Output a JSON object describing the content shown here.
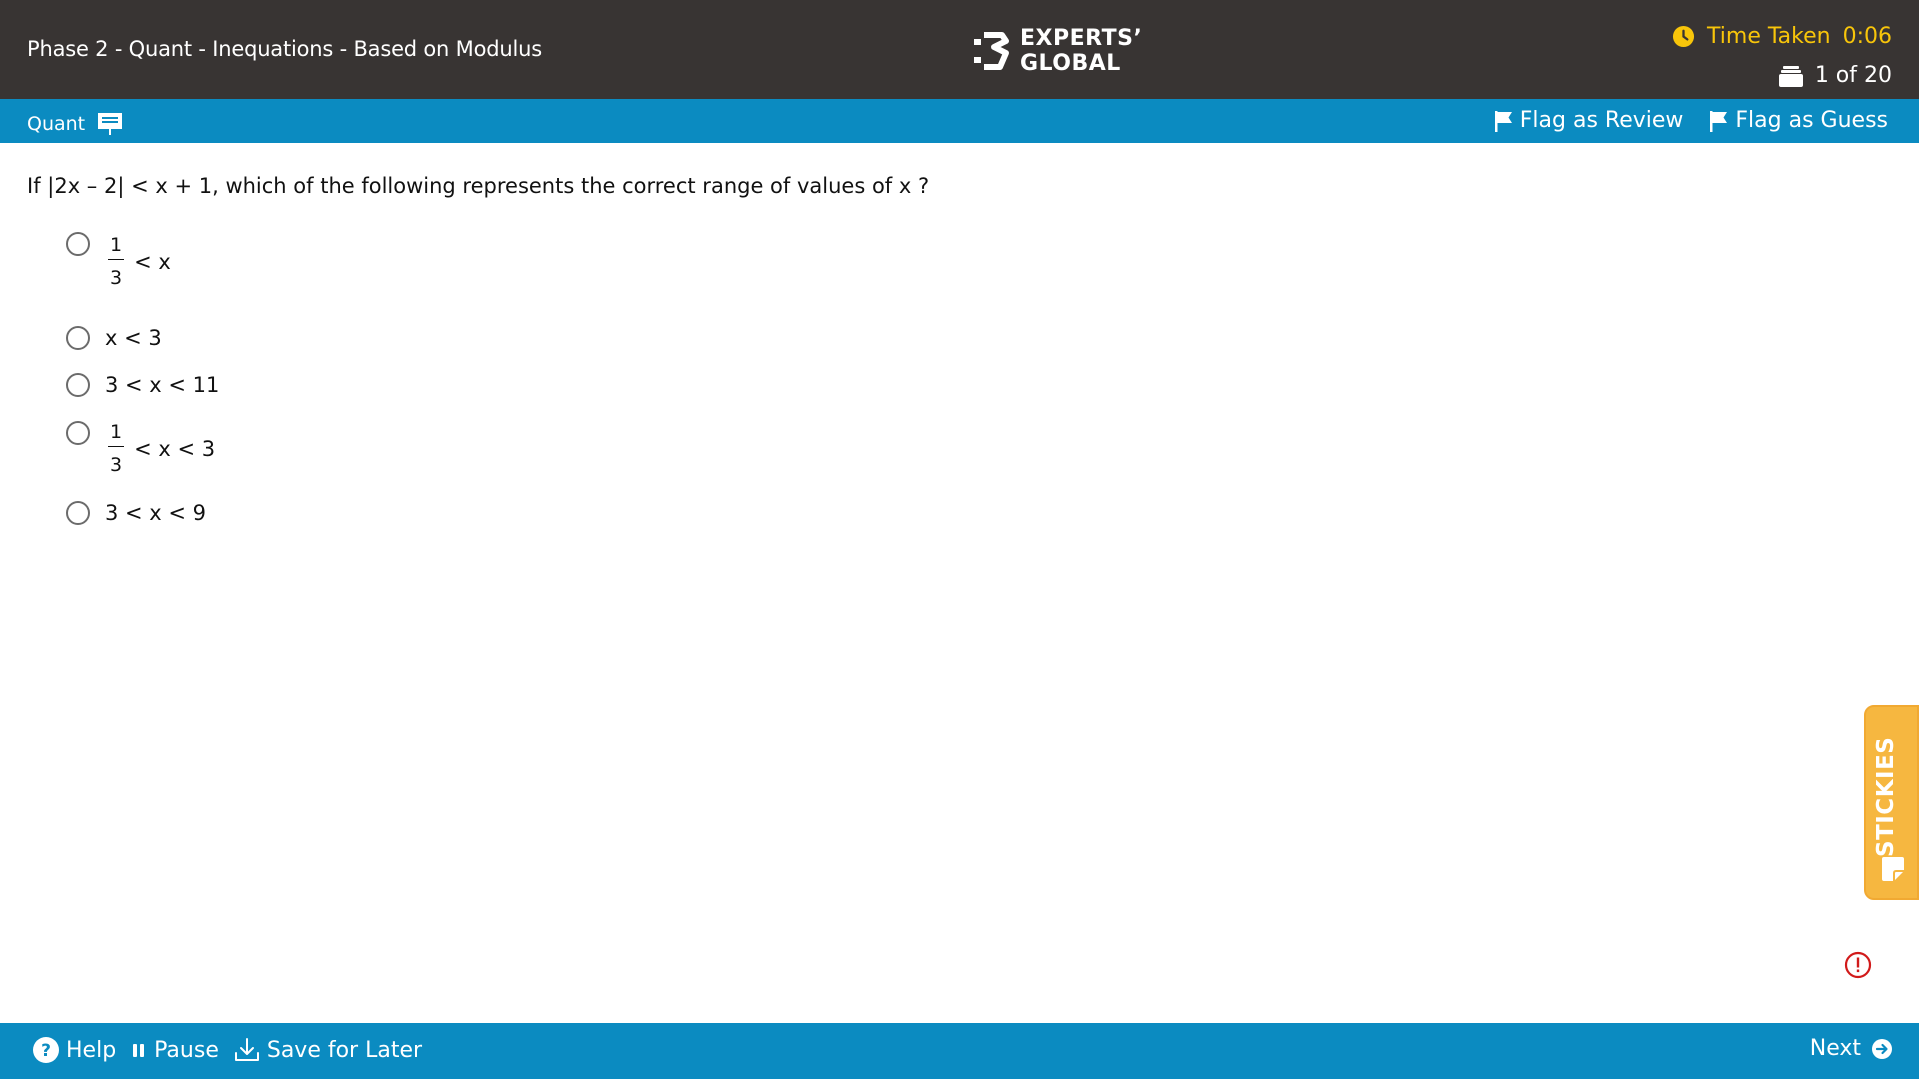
{
  "header": {
    "title": "Phase 2 - Quant - Inequations - Based on Modulus",
    "brand_line1": "EXPERTS’",
    "brand_line2": "GLOBAL",
    "timer_label": "Time Taken",
    "timer_value": "0:06",
    "question_counter": "1 of 20"
  },
  "section_bar": {
    "section_name": "Quant",
    "flag_review_label": "Flag as Review",
    "flag_guess_label": "Flag as Guess"
  },
  "question": {
    "text": "If |2x – 2| < x + 1, which of the following represents the correct range of values of x ?",
    "options": [
      {
        "numerator": "1",
        "denominator": "3",
        "rest": "< x"
      },
      {
        "text": "x < 3"
      },
      {
        "text": "3 < x < 11"
      },
      {
        "numerator": "1",
        "denominator": "3",
        "rest": "< x < 3"
      },
      {
        "text": "3 < x < 9"
      }
    ]
  },
  "stickies": {
    "label": "STICKIES"
  },
  "footer": {
    "help_label": "Help",
    "pause_label": "Pause",
    "save_label": "Save for Later",
    "next_label": "Next"
  },
  "colors": {
    "header_bg": "#383433",
    "accent_blue": "#0b8bc1",
    "timer_yellow": "#f8c50a",
    "stickies_orange": "#f6b740",
    "alert_red": "#d11a1a"
  },
  "icons": [
    "logo-mark-icon",
    "clock-icon",
    "question-stack-icon",
    "presentation-icon",
    "flag-icon",
    "sticky-note-icon",
    "alert-icon",
    "help-icon",
    "pause-icon",
    "download-icon",
    "arrow-right-circle-icon"
  ]
}
